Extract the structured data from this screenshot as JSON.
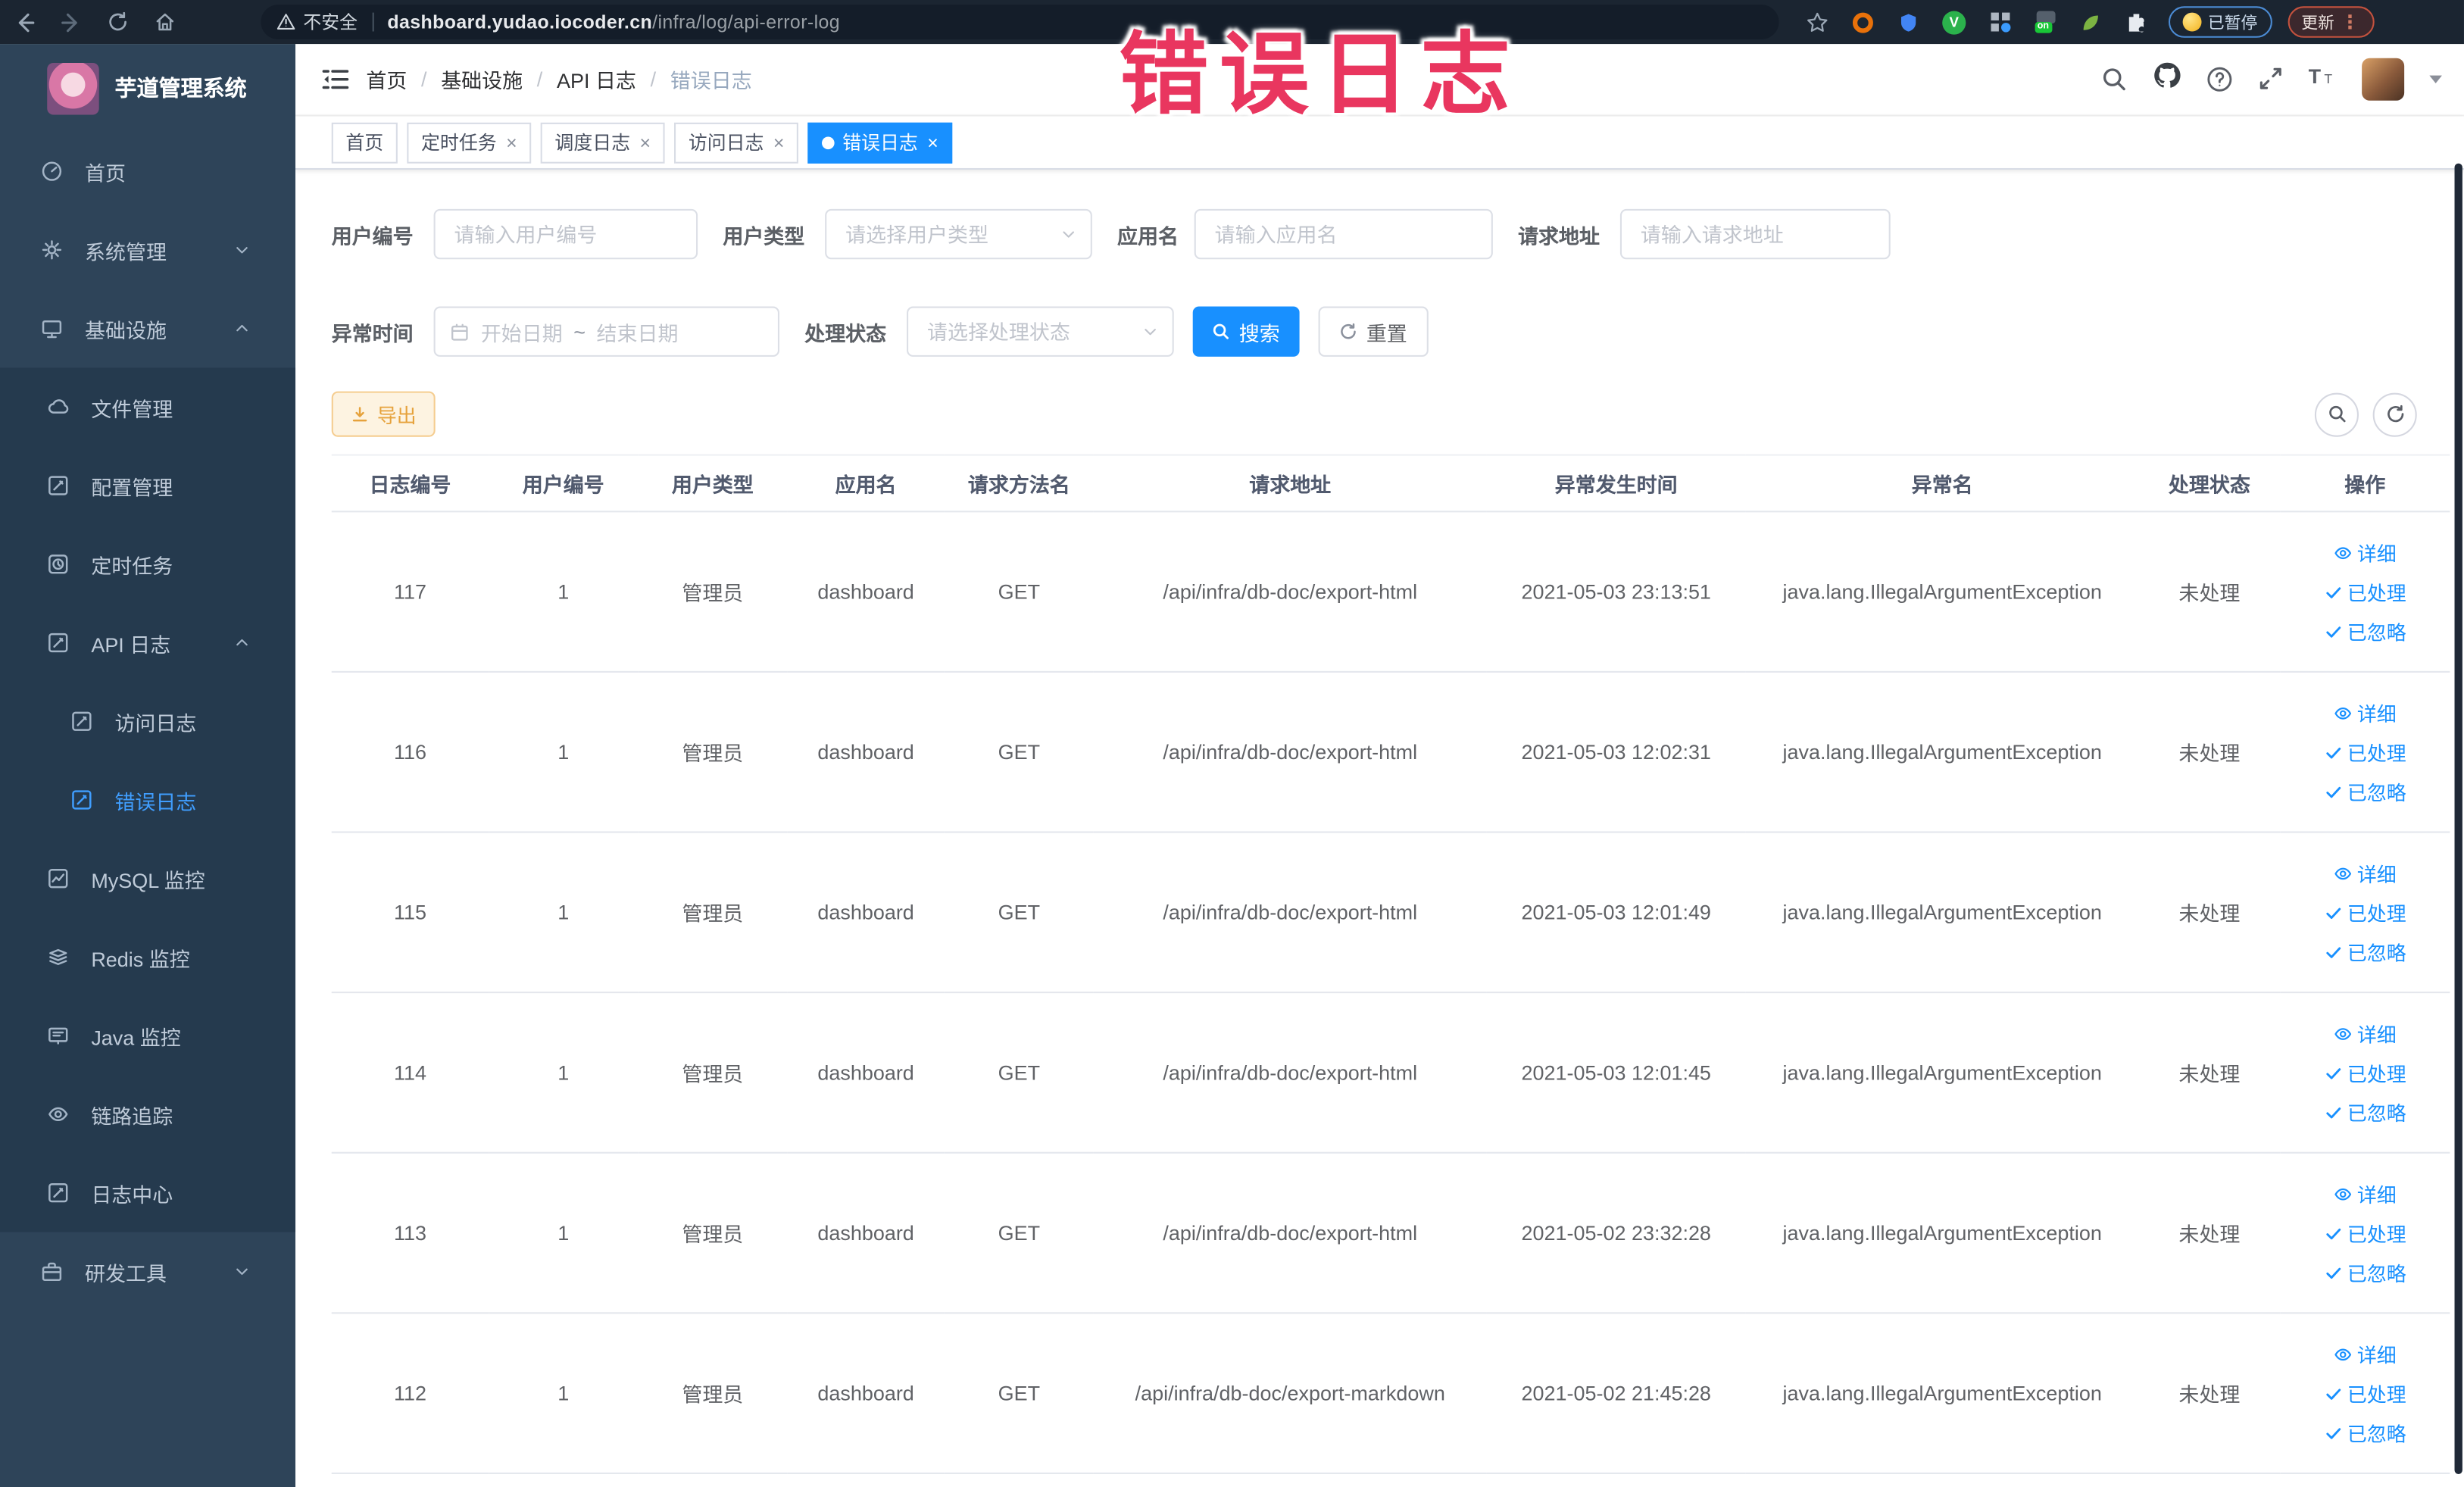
{
  "annotation": {
    "text": "错误日志",
    "color": "#e9365f"
  },
  "browser": {
    "security_label": "不安全",
    "url_host": "dashboard.yudao.iocoder.cn",
    "url_path": "/infra/log/api-error-log",
    "paused_badge": "已暂停",
    "update_button": "更新"
  },
  "sidebar": {
    "title": "芋道管理系统",
    "items": [
      {
        "label": "首页"
      },
      {
        "label": "系统管理"
      },
      {
        "label": "基础设施"
      },
      {
        "label": "文件管理"
      },
      {
        "label": "配置管理"
      },
      {
        "label": "定时任务"
      },
      {
        "label": "API 日志"
      },
      {
        "label": "访问日志"
      },
      {
        "label": "错误日志"
      },
      {
        "label": "MySQL 监控"
      },
      {
        "label": "Redis 监控"
      },
      {
        "label": "Java 监控"
      },
      {
        "label": "链路追踪"
      },
      {
        "label": "日志中心"
      },
      {
        "label": "研发工具"
      }
    ]
  },
  "breadcrumb": {
    "items": [
      "首页",
      "基础设施",
      "API 日志",
      "错误日志"
    ]
  },
  "tabs": [
    {
      "label": "首页"
    },
    {
      "label": "定时任务"
    },
    {
      "label": "调度日志"
    },
    {
      "label": "访问日志"
    },
    {
      "label": "错误日志"
    }
  ],
  "filters": {
    "user_id": {
      "label": "用户编号",
      "placeholder": "请输入用户编号"
    },
    "user_type": {
      "label": "用户类型",
      "placeholder": "请选择用户类型"
    },
    "app_name": {
      "label": "应用名",
      "placeholder": "请输入应用名"
    },
    "request_url": {
      "label": "请求地址",
      "placeholder": "请输入请求地址"
    },
    "exception_time": {
      "label": "异常时间",
      "start_placeholder": "开始日期",
      "separator": "~",
      "end_placeholder": "结束日期"
    },
    "process_status": {
      "label": "处理状态",
      "placeholder": "请选择处理状态"
    },
    "search_button": "搜索",
    "reset_button": "重置"
  },
  "toolbar": {
    "export_button": "导出"
  },
  "table": {
    "columns": [
      "日志编号",
      "用户编号",
      "用户类型",
      "应用名",
      "请求方法名",
      "请求地址",
      "异常发生时间",
      "异常名",
      "处理状态",
      "操作"
    ],
    "actions": [
      "详细",
      "已处理",
      "已忽略"
    ],
    "rows": [
      {
        "cells": [
          "117",
          "1",
          "管理员",
          "dashboard",
          "GET",
          "/api/infra/db-doc/export-html",
          "2021-05-03 23:13:51",
          "java.lang.IllegalArgumentException",
          "未处理"
        ]
      },
      {
        "cells": [
          "116",
          "1",
          "管理员",
          "dashboard",
          "GET",
          "/api/infra/db-doc/export-html",
          "2021-05-03 12:02:31",
          "java.lang.IllegalArgumentException",
          "未处理"
        ]
      },
      {
        "cells": [
          "115",
          "1",
          "管理员",
          "dashboard",
          "GET",
          "/api/infra/db-doc/export-html",
          "2021-05-03 12:01:49",
          "java.lang.IllegalArgumentException",
          "未处理"
        ]
      },
      {
        "cells": [
          "114",
          "1",
          "管理员",
          "dashboard",
          "GET",
          "/api/infra/db-doc/export-html",
          "2021-05-03 12:01:45",
          "java.lang.IllegalArgumentException",
          "未处理"
        ]
      },
      {
        "cells": [
          "113",
          "1",
          "管理员",
          "dashboard",
          "GET",
          "/api/infra/db-doc/export-html",
          "2021-05-02 23:32:28",
          "java.lang.IllegalArgumentException",
          "未处理"
        ]
      },
      {
        "cells": [
          "112",
          "1",
          "管理员",
          "dashboard",
          "GET",
          "/api/infra/db-doc/export-markdown",
          "2021-05-02 21:45:28",
          "java.lang.IllegalArgumentException",
          "未处理"
        ]
      }
    ]
  },
  "colors": {
    "accent_blue": "#1890ff",
    "sidebar_bg": "#2e4459",
    "submenu_bg": "#253a4e",
    "warn_orange": "#e6a23c"
  }
}
